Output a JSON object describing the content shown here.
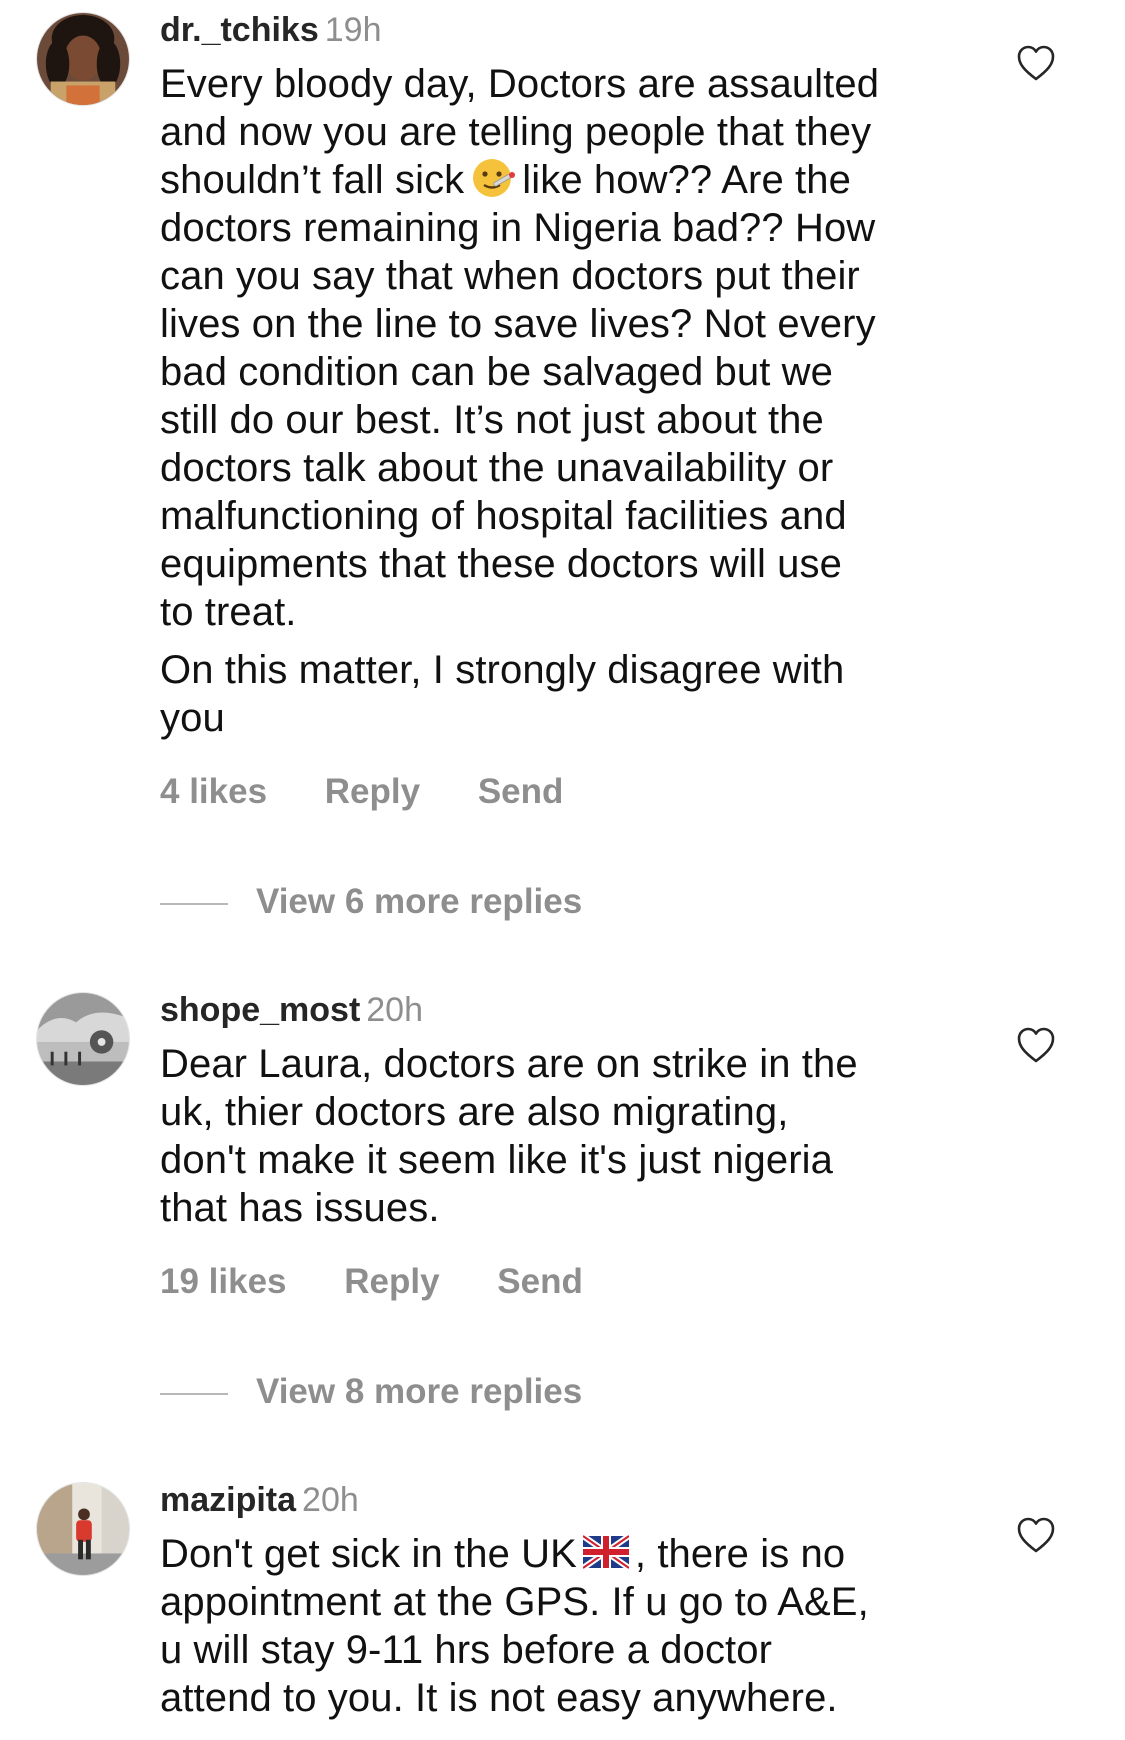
{
  "comments": [
    {
      "username": "dr._tchiks",
      "time": "19h",
      "paragraphs": [
        "Every bloody day, Doctors are assaulted\nand now you are telling people that they\nshouldn’t fall sick",
        "like how?? Are the\ndoctors remaining in Nigeria bad?? How\ncan you say that when doctors put their\nlives on the line to save lives? Not every\nbad condition can be salvaged but we\nstill do our best. It’s not just about the\ndoctors talk about the unavailability or\nmalfunctioning of hospital facilities and\nequipments that these doctors will use\nto treat.",
        "On this matter, I strongly disagree with\nyou"
      ],
      "emoji_icon": "face-with-thermometer-emoji",
      "likes": "4 likes",
      "reply_label": "Reply",
      "send_label": "Send",
      "view_replies": "View 6 more replies"
    },
    {
      "username": "shope_most",
      "time": "20h",
      "paragraphs": [
        "Dear Laura,  doctors are on strike in the\nuk, thier doctors are also migrating,\ndon't make it seem like it's just nigeria\nthat has issues."
      ],
      "likes": "19 likes",
      "reply_label": "Reply",
      "send_label": "Send",
      "view_replies": "View 8 more replies"
    },
    {
      "username": "mazipita",
      "time": "20h",
      "paragraphs": [
        "Don't get sick in the UK",
        ", there is no\nappointment at the GPS. If u go to A&E,\nu will stay 9-11 hrs before a doctor\nattend to you. It is not easy anywhere."
      ],
      "emoji_icon": "uk-flag-emoji"
    }
  ],
  "colors": {
    "text": "#111111",
    "username": "#262626",
    "muted": "#8e8e8e",
    "heart_outline": "#262626"
  }
}
